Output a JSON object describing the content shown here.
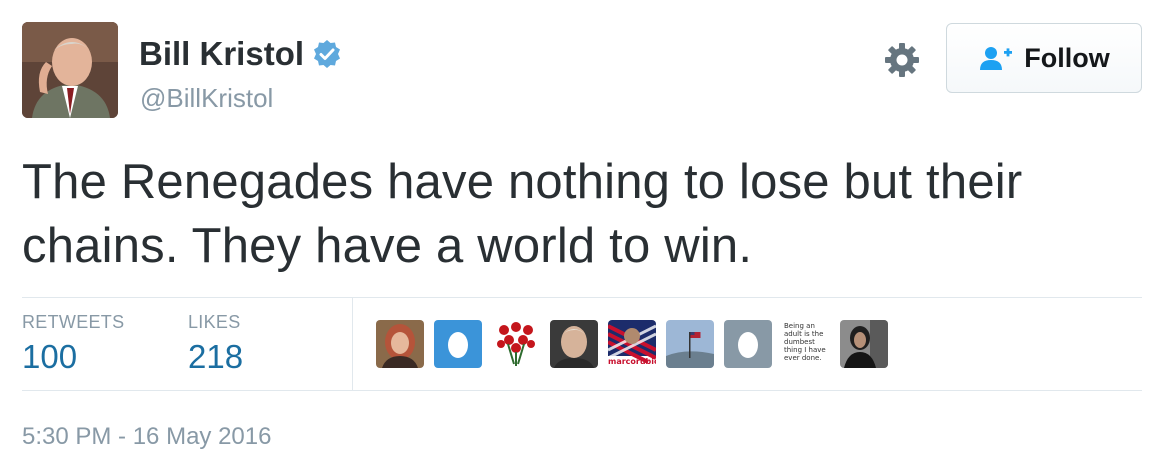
{
  "author": {
    "display_name": "Bill Kristol",
    "handle": "@BillKristol",
    "verified": true,
    "avatar_icon": "profile-photo"
  },
  "header": {
    "settings_icon": "gear-icon",
    "follow_label": "Follow",
    "follow_icon": "add-user-icon"
  },
  "tweet": {
    "text": "The Renegades have nothing to lose but their chains. They have a world to win.",
    "timestamp": "5:30 PM - 16 May 2016"
  },
  "stats": {
    "retweets_label": "RETWEETS",
    "retweets_value": "100",
    "likes_label": "LIKES",
    "likes_value": "218"
  },
  "likers": [
    {
      "icon": "profile-photo-woman"
    },
    {
      "icon": "default-egg-avatar-blue"
    },
    {
      "icon": "roses-avatar"
    },
    {
      "icon": "profile-photo-man"
    },
    {
      "icon": "rubio-supporter-avatar",
      "caption": "marcorubio"
    },
    {
      "icon": "flag-landscape-avatar"
    },
    {
      "icon": "default-egg-avatar-gray"
    },
    {
      "icon": "text-quote-avatar",
      "caption": "Being an adult is the dumbest thing I have ever done."
    },
    {
      "icon": "profile-photo-dark"
    }
  ],
  "colors": {
    "link_blue": "#1b6ea1",
    "muted_gray": "#8899a6",
    "verified_blue": "#1da1f2",
    "text_dark": "#292f33"
  }
}
